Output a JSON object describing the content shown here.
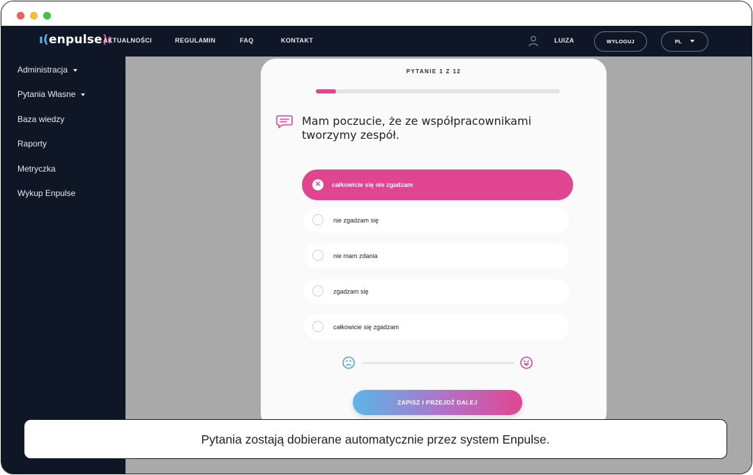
{
  "window": {
    "controls": [
      "close",
      "minimize",
      "maximize"
    ]
  },
  "navbar": {
    "logo": {
      "text": "enpulse"
    },
    "links": [
      "AKTUALNOŚCI",
      "REGULAMIN",
      "FAQ",
      "KONTAKT"
    ],
    "user_name": "LUIZA",
    "logout_label": "WYLOGUJ",
    "language": "PL"
  },
  "sidebar": {
    "items": [
      {
        "label": "Administracja",
        "has_caret": true
      },
      {
        "label": "Pytania Własne",
        "has_caret": true
      },
      {
        "label": "Baza wiedzy",
        "has_caret": false
      },
      {
        "label": "Raporty",
        "has_caret": false
      },
      {
        "label": "Metryczka",
        "has_caret": false
      },
      {
        "label": "Wykup Enpulse",
        "has_caret": false
      }
    ]
  },
  "survey": {
    "counter": "PYTANIE 1 Z 12",
    "progress": 0.083,
    "question": "Mam poczucie, że ze współpracownikami tworzymy zespół.",
    "options": [
      {
        "label": "całkowicie się nie zgadzam",
        "selected": true
      },
      {
        "label": "nie zgadzam się",
        "selected": false
      },
      {
        "label": "nie mam zdania",
        "selected": false
      },
      {
        "label": "zgadzam się",
        "selected": false
      },
      {
        "label": "całkowicie się zgadzam",
        "selected": false
      }
    ],
    "scale_icons": {
      "left": "sad-face-icon",
      "right": "happy-face-icon"
    },
    "submit_label": "ZAPISZ I PRZEJDŹ DALEJ"
  },
  "colors": {
    "accent_pink": "#e0468f",
    "accent_blue": "#5ab6e8",
    "navbar_bg": "#0f1726"
  },
  "caption": "Pytania zostają dobierane automatycznie przez system Enpulse."
}
